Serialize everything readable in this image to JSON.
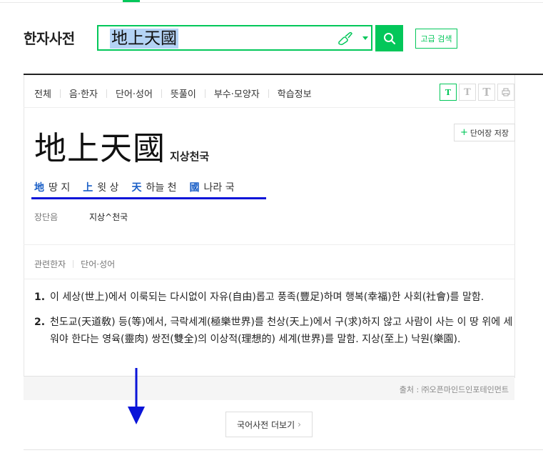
{
  "header": {
    "app_title": "한자사전",
    "search_value": "地上天國",
    "advanced_search_label": "고급 검색"
  },
  "tabs": [
    "전체",
    "음·한자",
    "단어·성어",
    "뜻풀이",
    "부수·모양자",
    "학습정보"
  ],
  "font_size_buttons": [
    "T",
    "T",
    "T"
  ],
  "entry": {
    "headword": "地上天國",
    "reading": "지상천국",
    "wordbook_label": "단어장 저장",
    "characters": [
      {
        "hanja": "地",
        "meaning": "땅 지"
      },
      {
        "hanja": "上",
        "meaning": "윗 상"
      },
      {
        "hanja": "天",
        "meaning": "하늘 천"
      },
      {
        "hanja": "國",
        "meaning": "나라 국"
      }
    ],
    "length_label": "장단음",
    "length_value": "지상^천국"
  },
  "related_tabs": [
    "관련한자",
    "단어·성어"
  ],
  "definitions": [
    {
      "num": "1.",
      "text": "이 세상(世上)에서 이룩되는 다시없이 자유(自由)롭고 풍족(豐足)하며 행복(幸福)한 사회(社會)를 말함."
    },
    {
      "num": "2.",
      "text": "천도교(天道敎) 등(等)에서, 극락세계(極樂世界)를 천상(天上)에서 구(求)하지 않고 사람이 사는 이 땅 위에 세워야 한다는 영육(靈肉) 쌍전(雙全)의 이상적(理想的) 세계(世界)를 말함. 지상(至上) 낙원(樂園)."
    }
  ],
  "source": "출처 : ㈜오픈마인드인포테인먼트",
  "more_button": "국어사전 더보기",
  "colors": {
    "accent": "#03c75a",
    "hanja_link": "#1a5fc7",
    "annotation_blue": "#0a14d8"
  }
}
